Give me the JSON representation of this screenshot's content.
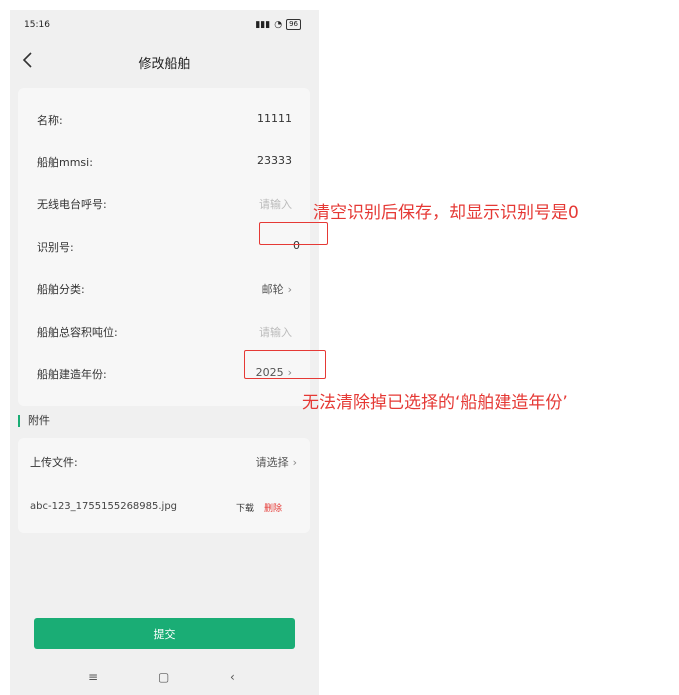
{
  "status": {
    "time": "15:16",
    "battery": "96"
  },
  "header": {
    "title": "修改船舶"
  },
  "form": [
    {
      "label": "名称:",
      "value": "11111",
      "placeholder": ""
    },
    {
      "label": "船舶mmsi:",
      "value": "23333",
      "placeholder": ""
    },
    {
      "label": "无线电台呼号:",
      "value": "",
      "placeholder": "请输入"
    },
    {
      "label": "识别号:",
      "value": "0",
      "placeholder": ""
    },
    {
      "label": "船舶分类:",
      "value": "邮轮",
      "placeholder": ""
    },
    {
      "label": "船舶总容积吨位:",
      "value": "",
      "placeholder": "请输入"
    },
    {
      "label": "船舶建造年份:",
      "value": "2025",
      "placeholder": ""
    }
  ],
  "attachments": {
    "section_title": "附件",
    "upload_label": "上传文件:",
    "upload_value": "请选择",
    "file_name": "abc-123_1755155268985.jpg",
    "download": "下载",
    "delete": "删除"
  },
  "submit_label": "提交",
  "annotations": {
    "note1": "清空识别后保存，却显示识别号是0",
    "note2": "无法清除掉已选择的‘船舶建造年份’"
  },
  "colors": {
    "accent": "#1aad75",
    "danger": "#e53935",
    "annotation": "#e53935"
  }
}
